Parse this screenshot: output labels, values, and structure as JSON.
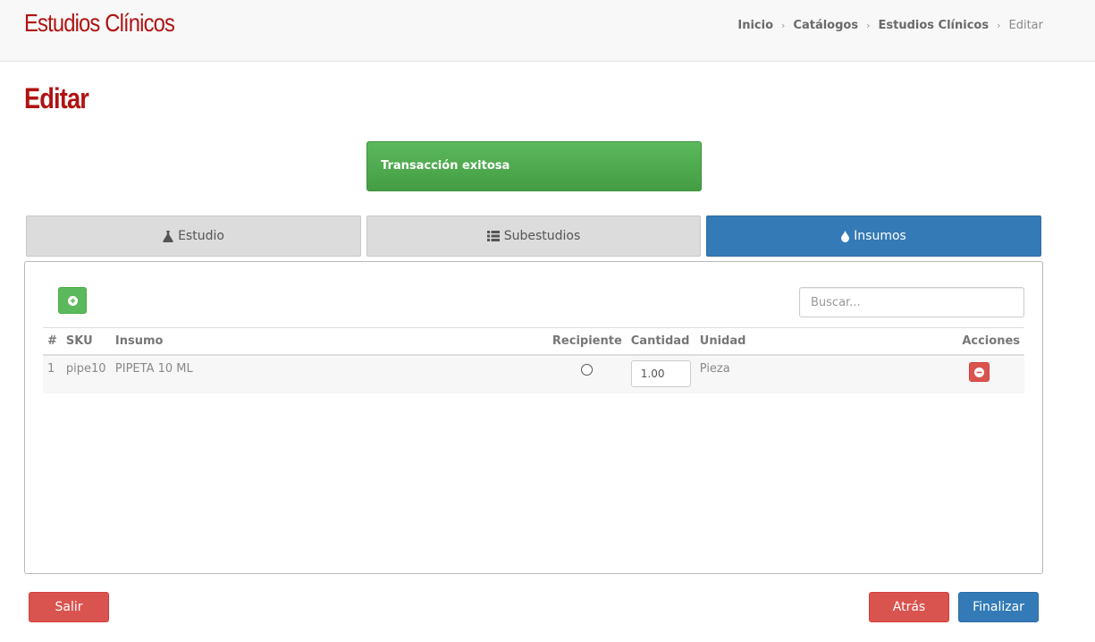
{
  "header": {
    "app_title": "Estudios Clínicos",
    "breadcrumb": [
      "Inicio",
      "Catálogos",
      "Estudios Clínicos",
      "Editar"
    ]
  },
  "page_title": "Editar",
  "alert": {
    "message": "Transacción exitosa",
    "color": "#5cb85c"
  },
  "tabs": [
    {
      "label": "Estudio",
      "icon": "flask-icon"
    },
    {
      "label": "Subestudios",
      "icon": "list-icon"
    },
    {
      "label": "Insumos",
      "icon": "droplet-icon",
      "active": true
    }
  ],
  "panel": {
    "add_icon": "plus-circle-icon",
    "search_placeholder": "Buscar...",
    "table": {
      "columns": [
        "#",
        "SKU",
        "Insumo",
        "Recipiente",
        "Cantidad",
        "Unidad",
        "Acciones"
      ],
      "rows": [
        {
          "num": "1",
          "sku": "pipe10",
          "insumo": "PIPETA 10 ML",
          "cantidad": "1.00",
          "unidad": "Pieza"
        }
      ]
    }
  },
  "footer": {
    "exit_label": "Salir",
    "back_label": "Atrás",
    "finish_label": "Finalizar"
  },
  "colors": {
    "brand": "#b01312",
    "primary": "#337ab7",
    "danger": "#d9534f",
    "success": "#5cb85c"
  }
}
